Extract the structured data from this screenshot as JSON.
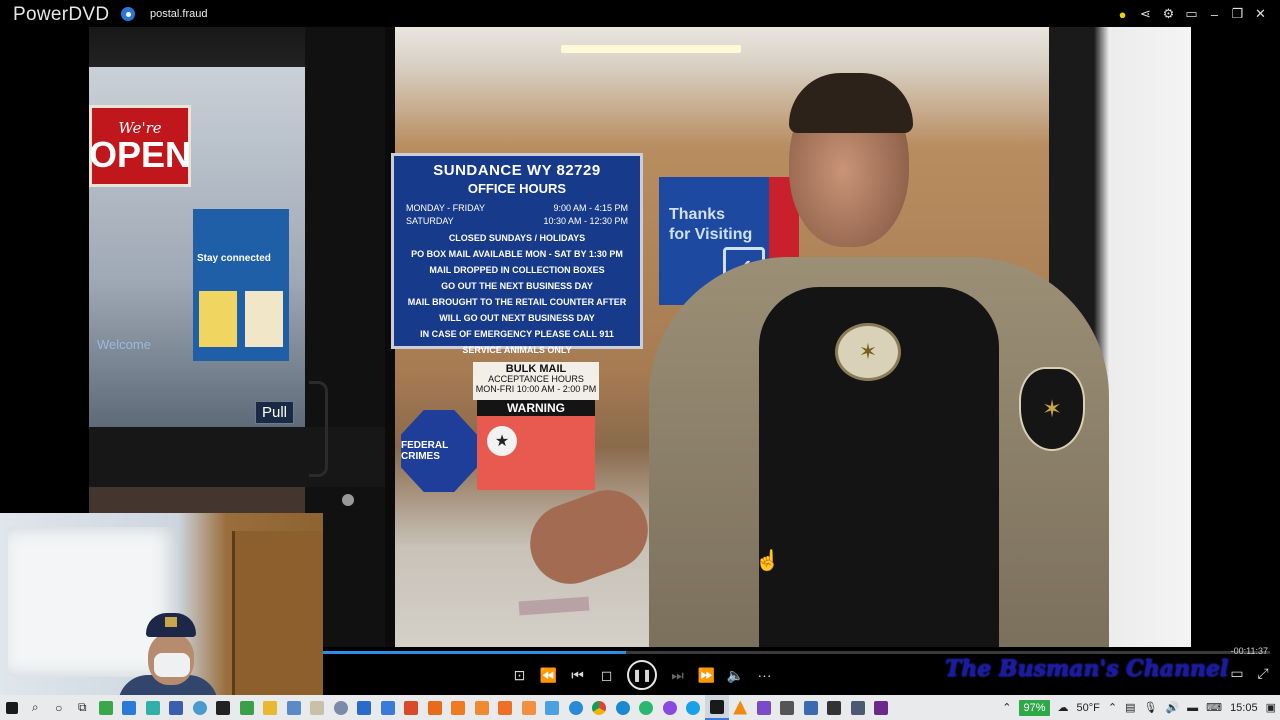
{
  "titlebar": {
    "app_name": "PowerDVD",
    "file_name": "postal.fraud",
    "icons": [
      "bulb-icon",
      "share-icon",
      "gear-icon",
      "mini-player-icon",
      "minimize-icon",
      "restore-icon",
      "close-icon"
    ],
    "bulb_color": "#f0d000"
  },
  "video": {
    "open_sign": {
      "top": "We're",
      "main": "OPEN"
    },
    "poster": {
      "header": "Stay connected",
      "welcome": "Welcome"
    },
    "door_label": "Pull",
    "hours_sign": {
      "line1": "SUNDANCE WY 82729",
      "line2": "OFFICE HOURS",
      "rows": [
        {
          "day": "MONDAY - FRIDAY",
          "time": "9:00 AM - 4:15 PM"
        },
        {
          "day": "SATURDAY",
          "time": "10:30 AM - 12:30 PM"
        }
      ],
      "closed": "CLOSED SUNDAYS / HOLIDAYS",
      "po_box": "PO BOX MAIL AVAILABLE MON - SAT BY 1:30 PM",
      "notes": [
        "MAIL DROPPED IN COLLECTION BOXES",
        "GO OUT THE NEXT BUSINESS DAY",
        "MAIL BROUGHT TO THE RETAIL COUNTER AFTER",
        "WILL GO OUT NEXT BUSINESS DAY",
        "IN CASE OF EMERGENCY PLEASE CALL 911",
        "SERVICE ANIMALS ONLY"
      ]
    },
    "bulk_sign": {
      "title": "BULK MAIL",
      "sub": "ACCEPTANCE HOURS",
      "hours": "MON-FRI 10:00 AM - 2:00 PM"
    },
    "warning_sign": {
      "title": "WARNING"
    },
    "alarm_sign": {
      "text": "FEDERAL CRIMES"
    },
    "thanks_sign": {
      "line1": "Thanks",
      "line2": "for Visiting"
    }
  },
  "player": {
    "progress_fraction": 0.32,
    "time_remaining": "-00:11:37",
    "seek_color": "#2b8fe4",
    "controls": [
      {
        "name": "bookmark-button",
        "glyph": "⊡"
      },
      {
        "name": "rewind-button",
        "glyph": "⏪"
      },
      {
        "name": "previous-button",
        "glyph": "⏮"
      },
      {
        "name": "stop-button",
        "glyph": "◻"
      },
      {
        "name": "pause-button",
        "glyph": "❚❚"
      },
      {
        "name": "next-button",
        "glyph": "⏭"
      },
      {
        "name": "fast-forward-button",
        "glyph": "⏩"
      },
      {
        "name": "volume-button",
        "glyph": "🔈"
      },
      {
        "name": "more-button",
        "glyph": "···"
      }
    ],
    "watermark": "The Busman's Channel"
  },
  "taskbar": {
    "battery": "97%",
    "weather": "50°F",
    "clock": "15:05"
  }
}
